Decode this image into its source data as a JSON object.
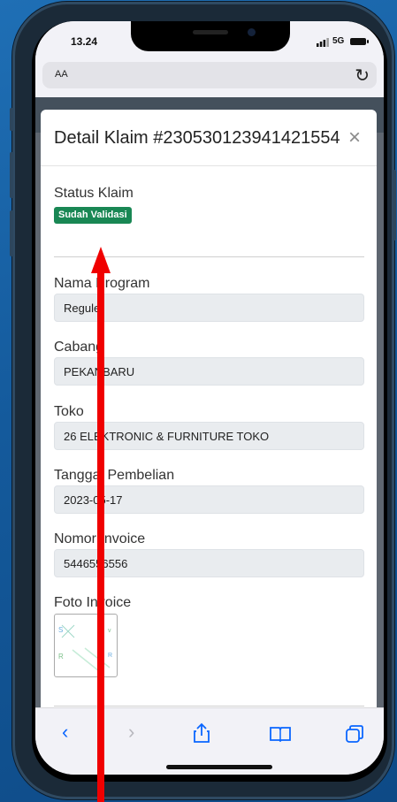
{
  "status_bar": {
    "time": "13.24",
    "network": "5G"
  },
  "address_bar": {
    "aa_label": "AA"
  },
  "modal": {
    "title": "Detail Klaim #230530123941421554",
    "status_label": "Status Klaim",
    "status_badge": "Sudah Validasi",
    "status_badge_color": "#198754",
    "fields": [
      {
        "label": "Nama Program",
        "value": "Reguler"
      },
      {
        "label": "Cabang",
        "value": "PEKANBARU"
      },
      {
        "label": "Toko",
        "value": "26 ELEKTRONIC & FURNITURE TOKO"
      },
      {
        "label": "Tanggal Pembelian",
        "value": "2023-05-17"
      },
      {
        "label": "Nomor Invoice",
        "value": "5446556556"
      }
    ],
    "photo_label": "Foto Invoice"
  },
  "toolbar": {
    "icons": [
      "back-icon",
      "forward-icon",
      "share-icon",
      "bookmarks-icon",
      "tabs-icon"
    ]
  },
  "colors": {
    "accent": "#0a66ff",
    "annotation": "#f00000"
  }
}
